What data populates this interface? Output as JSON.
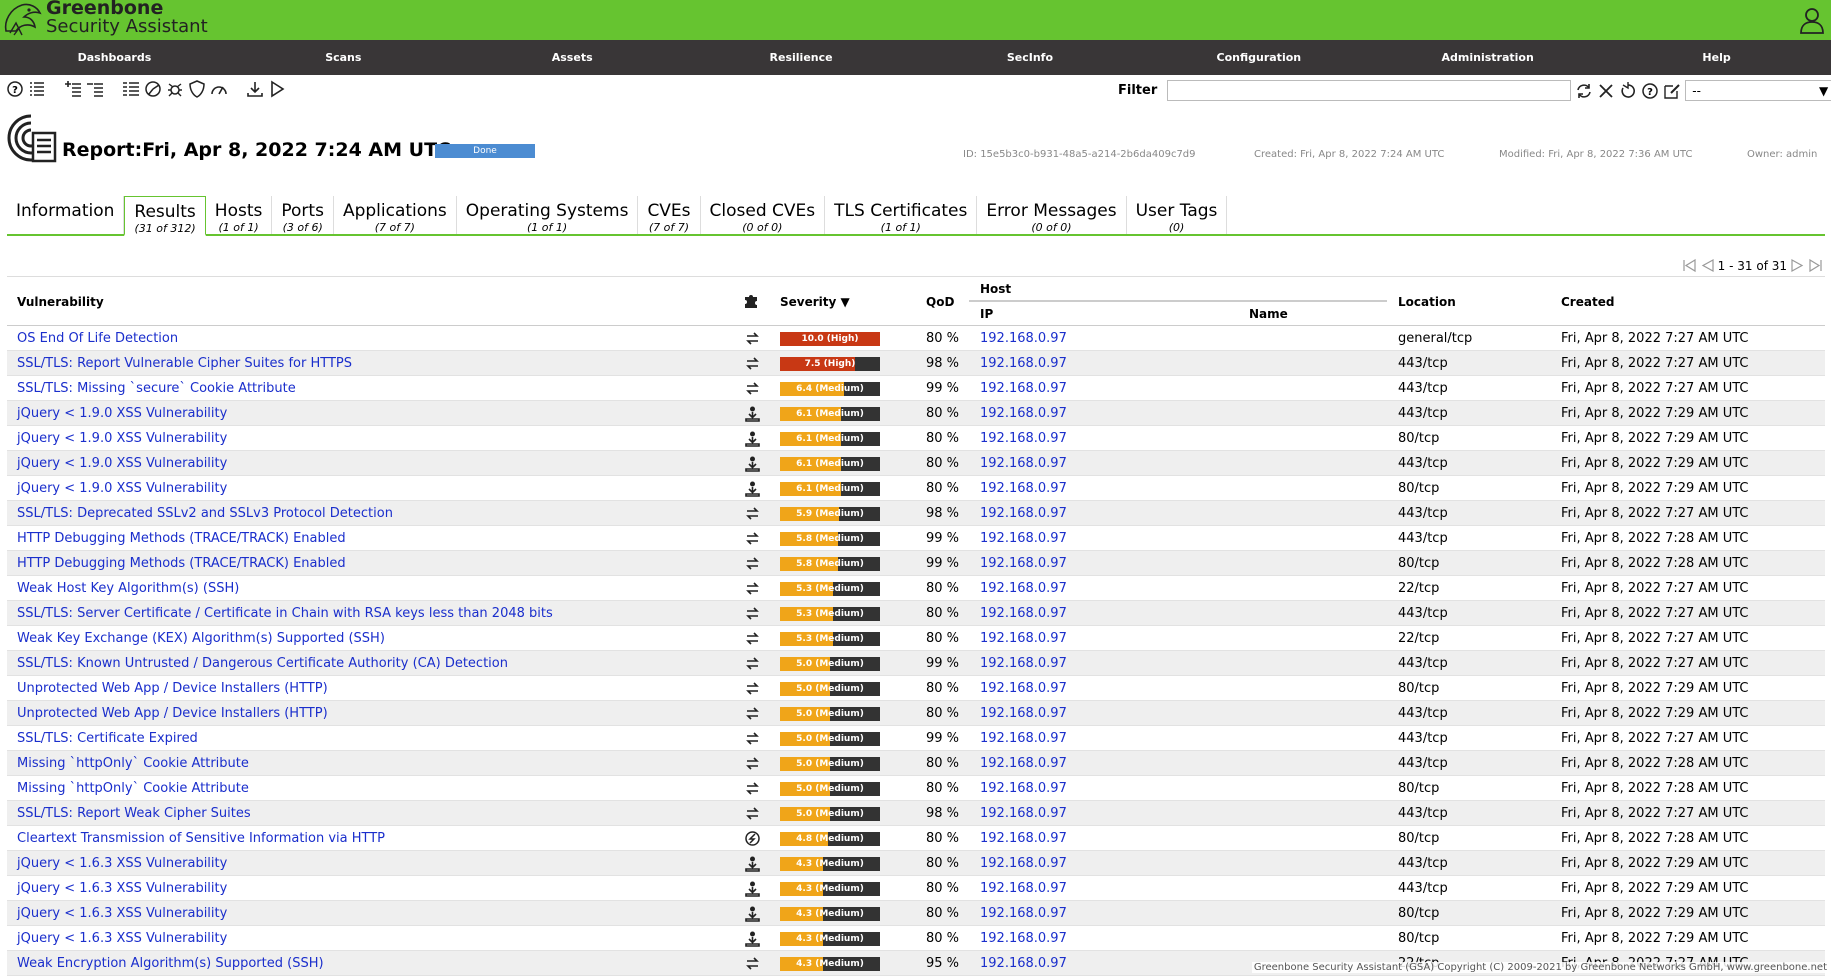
{
  "header": {
    "brand_line1": "Greenbone",
    "brand_line2": "Security Assistant",
    "accent": "#66c430"
  },
  "menu": [
    "Dashboards",
    "Scans",
    "Assets",
    "Resilience",
    "SecInfo",
    "Configuration",
    "Administration",
    "Help"
  ],
  "filter": {
    "label": "Filter",
    "value": "",
    "select_value": "--"
  },
  "report": {
    "title": "Report:Fri, Apr 8, 2022 7:24 AM UTC",
    "status": "Done",
    "id": "ID: 15e5b3c0-b931-48a5-a214-2b6da409c7d9",
    "created": "Created: Fri, Apr 8, 2022 7:24 AM UTC",
    "modified": "Modified: Fri, Apr 8, 2022 7:36 AM UTC",
    "owner": "Owner: admin"
  },
  "tabs": [
    {
      "label": "Information",
      "count": ""
    },
    {
      "label": "Results",
      "count": "(31 of 312)"
    },
    {
      "label": "Hosts",
      "count": "(1 of 1)"
    },
    {
      "label": "Ports",
      "count": "(3 of 6)"
    },
    {
      "label": "Applications",
      "count": "(7 of 7)"
    },
    {
      "label": "Operating Systems",
      "count": "(1 of 1)"
    },
    {
      "label": "CVEs",
      "count": "(7 of 7)"
    },
    {
      "label": "Closed CVEs",
      "count": "(0 of 0)"
    },
    {
      "label": "TLS Certificates",
      "count": "(1 of 1)"
    },
    {
      "label": "Error Messages",
      "count": "(0 of 0)"
    },
    {
      "label": "User Tags",
      "count": "(0)"
    }
  ],
  "pager": {
    "text": "1 - 31 of 31"
  },
  "columns": {
    "vulnerability": "Vulnerability",
    "severity": "Severity ▼",
    "qod": "QoD",
    "host": "Host",
    "ip": "IP",
    "name": "Name",
    "location": "Location",
    "created": "Created"
  },
  "rows": [
    {
      "name": "OS End Of Life Detection",
      "sol": "vendorfix",
      "sev": 10.0,
      "sevtxt": "10.0 (High)",
      "level": "high",
      "qod": "80 %",
      "ip": "192.168.0.97",
      "loc": "general/tcp",
      "created": "Fri, Apr 8, 2022 7:27 AM UTC"
    },
    {
      "name": "SSL/TLS: Report Vulnerable Cipher Suites for HTTPS",
      "sol": "vendorfix",
      "sev": 7.5,
      "sevtxt": "7.5 (High)",
      "level": "high",
      "qod": "98 %",
      "ip": "192.168.0.97",
      "loc": "443/tcp",
      "created": "Fri, Apr 8, 2022 7:27 AM UTC"
    },
    {
      "name": "SSL/TLS: Missing `secure` Cookie Attribute",
      "sol": "vendorfix",
      "sev": 6.4,
      "sevtxt": "6.4 (Medium)",
      "level": "medium",
      "qod": "99 %",
      "ip": "192.168.0.97",
      "loc": "443/tcp",
      "created": "Fri, Apr 8, 2022 7:27 AM UTC"
    },
    {
      "name": "jQuery < 1.9.0 XSS Vulnerability",
      "sol": "upgrade",
      "sev": 6.1,
      "sevtxt": "6.1 (Medium)",
      "level": "medium",
      "qod": "80 %",
      "ip": "192.168.0.97",
      "loc": "443/tcp",
      "created": "Fri, Apr 8, 2022 7:29 AM UTC"
    },
    {
      "name": "jQuery < 1.9.0 XSS Vulnerability",
      "sol": "upgrade",
      "sev": 6.1,
      "sevtxt": "6.1 (Medium)",
      "level": "medium",
      "qod": "80 %",
      "ip": "192.168.0.97",
      "loc": "80/tcp",
      "created": "Fri, Apr 8, 2022 7:29 AM UTC"
    },
    {
      "name": "jQuery < 1.9.0 XSS Vulnerability",
      "sol": "upgrade",
      "sev": 6.1,
      "sevtxt": "6.1 (Medium)",
      "level": "medium",
      "qod": "80 %",
      "ip": "192.168.0.97",
      "loc": "443/tcp",
      "created": "Fri, Apr 8, 2022 7:29 AM UTC"
    },
    {
      "name": "jQuery < 1.9.0 XSS Vulnerability",
      "sol": "upgrade",
      "sev": 6.1,
      "sevtxt": "6.1 (Medium)",
      "level": "medium",
      "qod": "80 %",
      "ip": "192.168.0.97",
      "loc": "80/tcp",
      "created": "Fri, Apr 8, 2022 7:29 AM UTC"
    },
    {
      "name": "SSL/TLS: Deprecated SSLv2 and SSLv3 Protocol Detection",
      "sol": "vendorfix",
      "sev": 5.9,
      "sevtxt": "5.9 (Medium)",
      "level": "medium",
      "qod": "98 %",
      "ip": "192.168.0.97",
      "loc": "443/tcp",
      "created": "Fri, Apr 8, 2022 7:27 AM UTC"
    },
    {
      "name": "HTTP Debugging Methods (TRACE/TRACK) Enabled",
      "sol": "vendorfix",
      "sev": 5.8,
      "sevtxt": "5.8 (Medium)",
      "level": "medium",
      "qod": "99 %",
      "ip": "192.168.0.97",
      "loc": "443/tcp",
      "created": "Fri, Apr 8, 2022 7:28 AM UTC"
    },
    {
      "name": "HTTP Debugging Methods (TRACE/TRACK) Enabled",
      "sol": "vendorfix",
      "sev": 5.8,
      "sevtxt": "5.8 (Medium)",
      "level": "medium",
      "qod": "99 %",
      "ip": "192.168.0.97",
      "loc": "80/tcp",
      "created": "Fri, Apr 8, 2022 7:28 AM UTC"
    },
    {
      "name": "Weak Host Key Algorithm(s) (SSH)",
      "sol": "vendorfix",
      "sev": 5.3,
      "sevtxt": "5.3 (Medium)",
      "level": "medium",
      "qod": "80 %",
      "ip": "192.168.0.97",
      "loc": "22/tcp",
      "created": "Fri, Apr 8, 2022 7:27 AM UTC"
    },
    {
      "name": "SSL/TLS: Server Certificate / Certificate in Chain with RSA keys less than 2048 bits",
      "sol": "vendorfix",
      "sev": 5.3,
      "sevtxt": "5.3 (Medium)",
      "level": "medium",
      "qod": "80 %",
      "ip": "192.168.0.97",
      "loc": "443/tcp",
      "created": "Fri, Apr 8, 2022 7:27 AM UTC"
    },
    {
      "name": "Weak Key Exchange (KEX) Algorithm(s) Supported (SSH)",
      "sol": "vendorfix",
      "sev": 5.3,
      "sevtxt": "5.3 (Medium)",
      "level": "medium",
      "qod": "80 %",
      "ip": "192.168.0.97",
      "loc": "22/tcp",
      "created": "Fri, Apr 8, 2022 7:27 AM UTC"
    },
    {
      "name": "SSL/TLS: Known Untrusted / Dangerous Certificate Authority (CA) Detection",
      "sol": "vendorfix",
      "sev": 5.0,
      "sevtxt": "5.0 (Medium)",
      "level": "medium",
      "qod": "99 %",
      "ip": "192.168.0.97",
      "loc": "443/tcp",
      "created": "Fri, Apr 8, 2022 7:27 AM UTC"
    },
    {
      "name": "Unprotected Web App / Device Installers (HTTP)",
      "sol": "vendorfix",
      "sev": 5.0,
      "sevtxt": "5.0 (Medium)",
      "level": "medium",
      "qod": "80 %",
      "ip": "192.168.0.97",
      "loc": "80/tcp",
      "created": "Fri, Apr 8, 2022 7:29 AM UTC"
    },
    {
      "name": "Unprotected Web App / Device Installers (HTTP)",
      "sol": "vendorfix",
      "sev": 5.0,
      "sevtxt": "5.0 (Medium)",
      "level": "medium",
      "qod": "80 %",
      "ip": "192.168.0.97",
      "loc": "443/tcp",
      "created": "Fri, Apr 8, 2022 7:29 AM UTC"
    },
    {
      "name": "SSL/TLS: Certificate Expired",
      "sol": "vendorfix",
      "sev": 5.0,
      "sevtxt": "5.0 (Medium)",
      "level": "medium",
      "qod": "99 %",
      "ip": "192.168.0.97",
      "loc": "443/tcp",
      "created": "Fri, Apr 8, 2022 7:27 AM UTC"
    },
    {
      "name": "Missing `httpOnly` Cookie Attribute",
      "sol": "vendorfix",
      "sev": 5.0,
      "sevtxt": "5.0 (Medium)",
      "level": "medium",
      "qod": "80 %",
      "ip": "192.168.0.97",
      "loc": "443/tcp",
      "created": "Fri, Apr 8, 2022 7:28 AM UTC"
    },
    {
      "name": "Missing `httpOnly` Cookie Attribute",
      "sol": "vendorfix",
      "sev": 5.0,
      "sevtxt": "5.0 (Medium)",
      "level": "medium",
      "qod": "80 %",
      "ip": "192.168.0.97",
      "loc": "80/tcp",
      "created": "Fri, Apr 8, 2022 7:28 AM UTC"
    },
    {
      "name": "SSL/TLS: Report Weak Cipher Suites",
      "sol": "vendorfix",
      "sev": 5.0,
      "sevtxt": "5.0 (Medium)",
      "level": "medium",
      "qod": "98 %",
      "ip": "192.168.0.97",
      "loc": "443/tcp",
      "created": "Fri, Apr 8, 2022 7:27 AM UTC"
    },
    {
      "name": "Cleartext Transmission of Sensitive Information via HTTP",
      "sol": "workaround",
      "sev": 4.8,
      "sevtxt": "4.8 (Medium)",
      "level": "medium",
      "qod": "80 %",
      "ip": "192.168.0.97",
      "loc": "80/tcp",
      "created": "Fri, Apr 8, 2022 7:28 AM UTC"
    },
    {
      "name": "jQuery < 1.6.3 XSS Vulnerability",
      "sol": "upgrade",
      "sev": 4.3,
      "sevtxt": "4.3 (Medium)",
      "level": "medium",
      "qod": "80 %",
      "ip": "192.168.0.97",
      "loc": "443/tcp",
      "created": "Fri, Apr 8, 2022 7:29 AM UTC"
    },
    {
      "name": "jQuery < 1.6.3 XSS Vulnerability",
      "sol": "upgrade",
      "sev": 4.3,
      "sevtxt": "4.3 (Medium)",
      "level": "medium",
      "qod": "80 %",
      "ip": "192.168.0.97",
      "loc": "443/tcp",
      "created": "Fri, Apr 8, 2022 7:29 AM UTC"
    },
    {
      "name": "jQuery < 1.6.3 XSS Vulnerability",
      "sol": "upgrade",
      "sev": 4.3,
      "sevtxt": "4.3 (Medium)",
      "level": "medium",
      "qod": "80 %",
      "ip": "192.168.0.97",
      "loc": "80/tcp",
      "created": "Fri, Apr 8, 2022 7:29 AM UTC"
    },
    {
      "name": "jQuery < 1.6.3 XSS Vulnerability",
      "sol": "upgrade",
      "sev": 4.3,
      "sevtxt": "4.3 (Medium)",
      "level": "medium",
      "qod": "80 %",
      "ip": "192.168.0.97",
      "loc": "80/tcp",
      "created": "Fri, Apr 8, 2022 7:29 AM UTC"
    },
    {
      "name": "Weak Encryption Algorithm(s) Supported (SSH)",
      "sol": "vendorfix",
      "sev": 4.3,
      "sevtxt": "4.3 (Medium)",
      "level": "medium",
      "qod": "95 %",
      "ip": "192.168.0.97",
      "loc": "22/tcp",
      "created": "Fri, Apr 8, 2022 7:27 AM UTC"
    }
  ],
  "severity_colors": {
    "high": "#c83814",
    "medium": "#f0a519",
    "bar_bg": "#333333"
  },
  "footer": "Greenbone Security Assistant (GSA) Copyright (C) 2009-2021 by Greenbone Networks GmbH, www.greenbone.net"
}
